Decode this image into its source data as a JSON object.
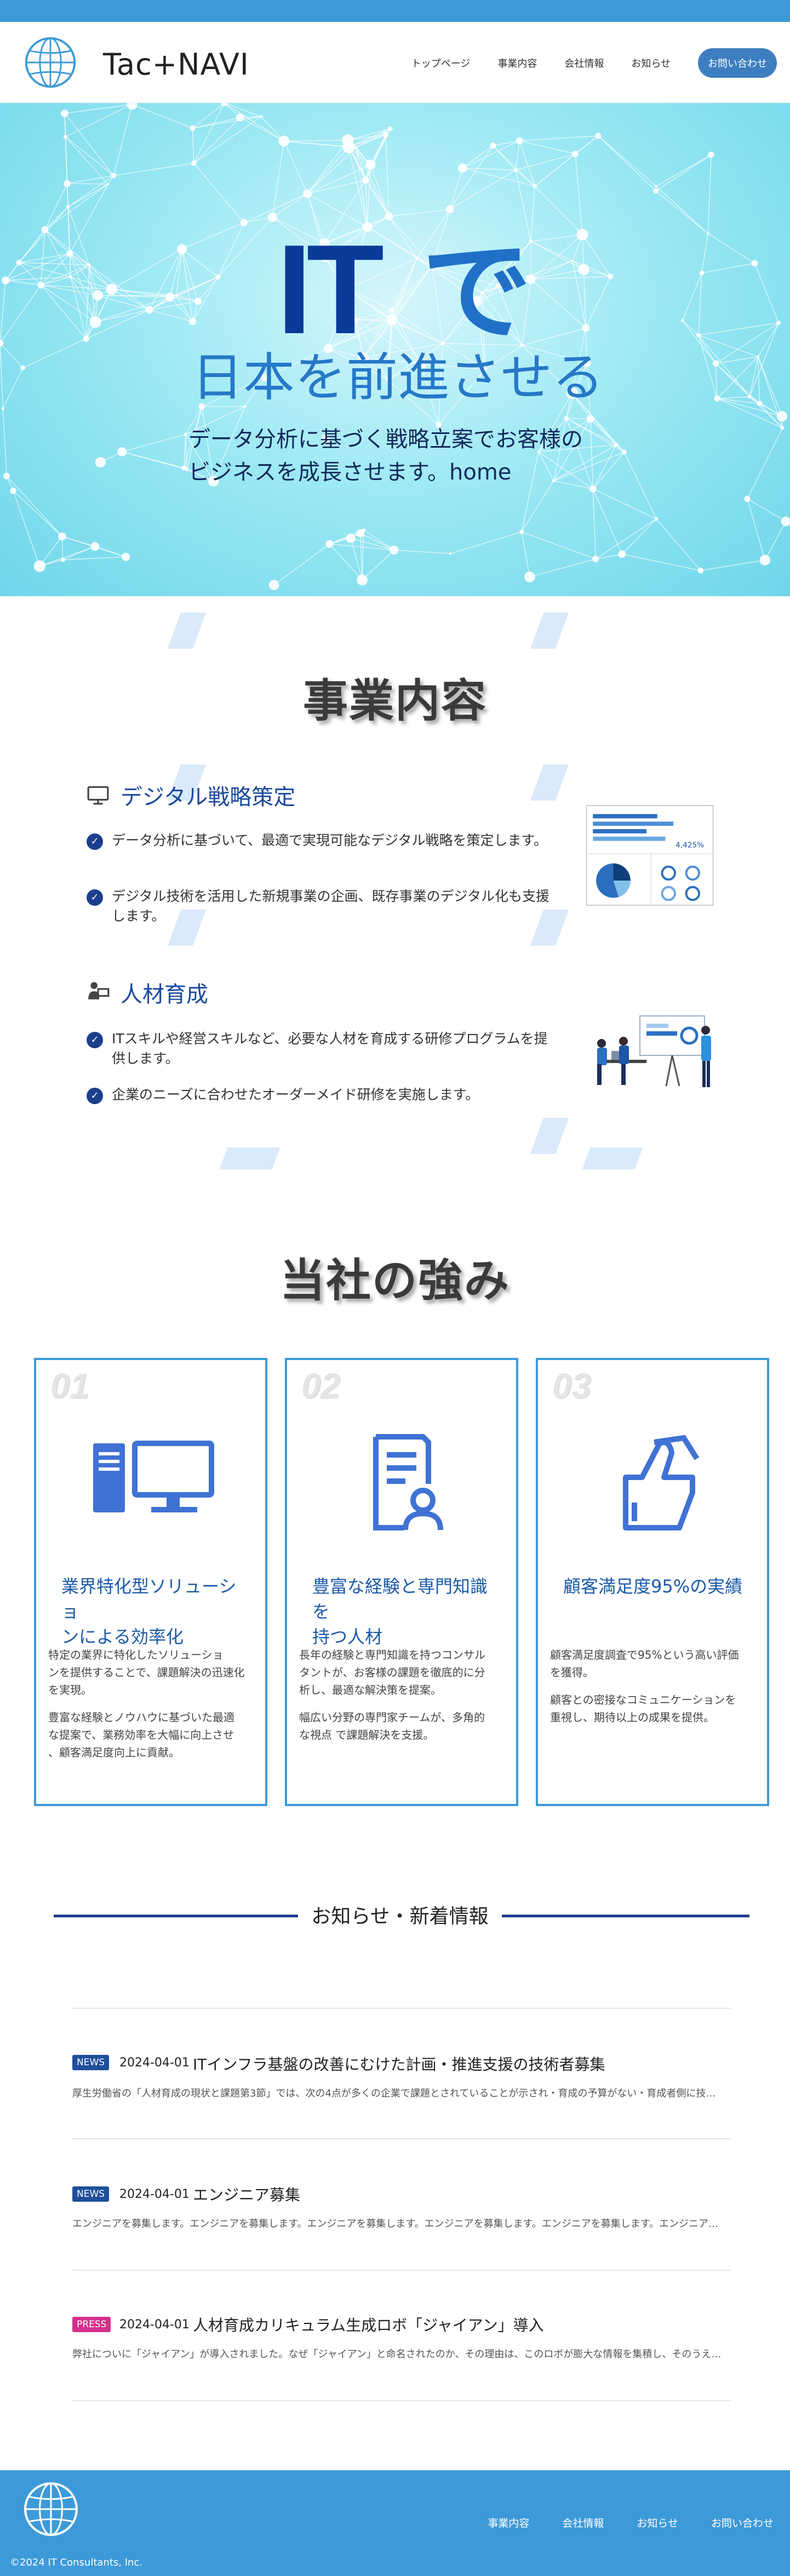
{
  "header": {
    "logo_text": "Tac+NAVI",
    "nav": [
      "トップページ",
      "事業内容",
      "会社情報",
      "お知らせ"
    ],
    "cta": "お問い合わせ"
  },
  "hero": {
    "title_it": "IT",
    "title_de": "で",
    "subtitle": "日本を前進させる",
    "desc_line1": "データ分析に基づく戦略立案でお客様の",
    "desc_line2": "ビジネスを成長させます。home"
  },
  "business": {
    "title": "事業内容",
    "services": [
      {
        "heading": "デジタル戦略策定",
        "icon": "monitor-icon",
        "items": [
          "データ分析に基づいて、最適で実現可能なデジタル戦略を策定します。",
          "デジタル技術を活用した新規事業の企画、既存事業のデジタル化も支援します。"
        ],
        "chart_label": "4,425%"
      },
      {
        "heading": "人材育成",
        "icon": "person-teaching-icon",
        "items": [
          "ITスキルや経営スキルなど、必要な人材を育成する研修プログラムを提供します。",
          "企業のニーズに合わせたオーダーメイド研修を実施します。"
        ]
      }
    ]
  },
  "strengths": {
    "title": "当社の強み",
    "cards": [
      {
        "num": "01",
        "icon": "desktop-computer-icon",
        "title_line1": "業界特化型ソリューショ",
        "title_line2": "ンによる効率化",
        "p1": [
          "特定の業界に特化したソリューショ",
          "ンを提供することで、課題解決の迅速化",
          "を実現。"
        ],
        "p2": [
          "豊富な経験とノウハウに基づいた最適",
          "な提案で、業務効率を大幅に向上させ",
          "、顧客満足度向上に貢献。"
        ]
      },
      {
        "num": "02",
        "icon": "document-person-icon",
        "title_line1": "豊富な経験と専門知識を",
        "title_line2": "持つ人材",
        "p1": [
          "長年の経験と専門知識を持つコンサル",
          "タントが、お客様の課題を徹底的に分",
          "析し、最適な解決策を提案。"
        ],
        "p2": [
          "幅広い分野の専門家チームが、多角的",
          "な視点 で課題解決を支援。"
        ]
      },
      {
        "num": "03",
        "icon": "thumbs-up-icon",
        "title_line1": "顧客満足度95%の実績",
        "title_line2": "",
        "p1": [
          "顧客満足度調査で95%という高い評価",
          "を獲得。"
        ],
        "p2": [
          "顧客との密接なコミュニケーションを",
          "重視し、期待以上の成果を提供。"
        ]
      }
    ]
  },
  "news": {
    "title": "お知らせ・新着情報",
    "items": [
      {
        "badge": "NEWS",
        "badge_color": "#1f4e9a",
        "date": "2024-04-01",
        "title": "ITインフラ基盤の改善にむけた計画・推進支援の技術者募集",
        "excerpt": "厚生労働省の「人材育成の現状と課題第3節」では、次の4点が多くの企業で課題とされていることが示され・育成の予算がない・育成者側に技…"
      },
      {
        "badge": "NEWS",
        "badge_color": "#1f4e9a",
        "date": "2024-04-01",
        "title": "エンジニア募集",
        "excerpt": "エンジニアを募集します。エンジニアを募集します。エンジニアを募集します。エンジニアを募集します。エンジニアを募集します。エンジニア…"
      },
      {
        "badge": "PRESS",
        "badge_color": "#d4308c",
        "date": "2024-04-01",
        "title": "人材育成カリキュラム生成ロボ「ジャイアン」導入",
        "excerpt": "弊社についに「ジャイアン」が導入されました。なぜ「ジャイアン」と命名されたのか、その理由は、このロボが膨大な情報を集積し、そのうえ…"
      }
    ]
  },
  "footer": {
    "nav": [
      "事業内容",
      "会社情報",
      "お知らせ",
      "お問い合わせ"
    ],
    "copyright": "©2024 IT Consultants, Inc."
  },
  "colors": {
    "brand_blue": "#3d9ad8",
    "navy": "#1b3f8c",
    "heading_blue": "#1b4aa0"
  }
}
